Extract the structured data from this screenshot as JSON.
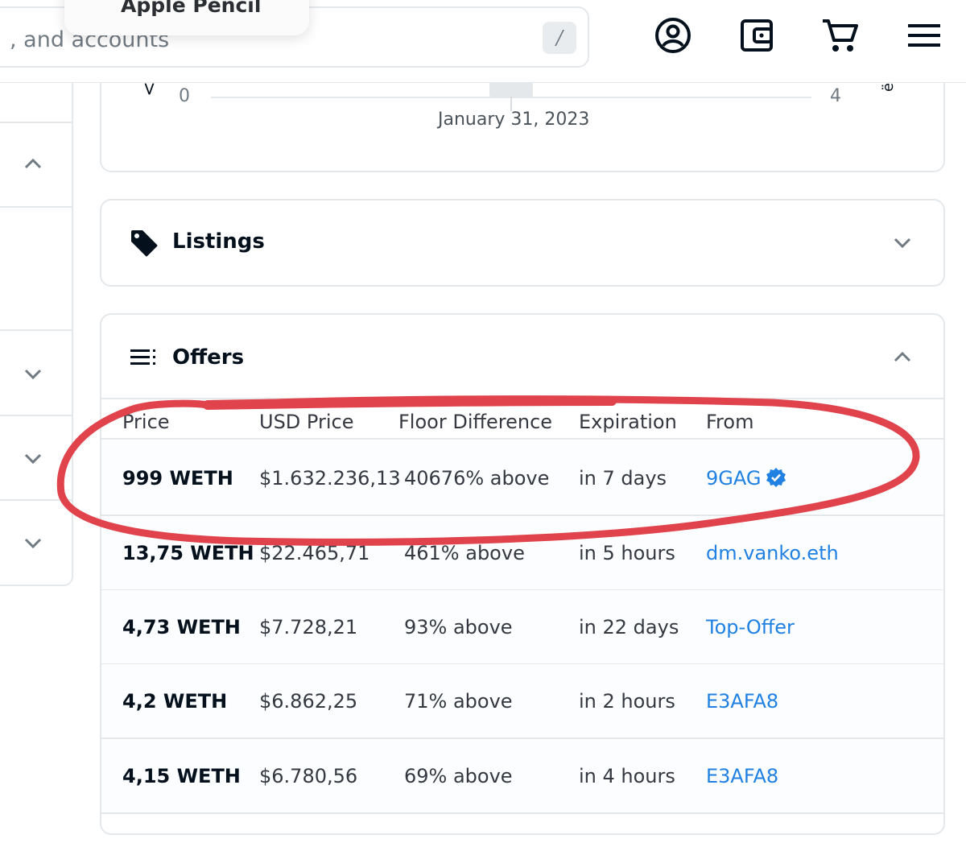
{
  "header": {
    "search_placeholder": ", and accounts",
    "search_shortcut": "/",
    "tooltip_label": "Apple Pencil",
    "icons": [
      "account-icon",
      "wallet-icon",
      "cart-icon",
      "menu-icon"
    ]
  },
  "chart": {
    "y_left_label": ">",
    "y_right_label": "ë",
    "axis_min": "0",
    "axis_max": "4",
    "date_label": "January 31, 2023"
  },
  "listings": {
    "title": "Listings"
  },
  "offers": {
    "title": "Offers",
    "columns": [
      "Price",
      "USD Price",
      "Floor Difference",
      "Expiration",
      "From"
    ],
    "rows": [
      {
        "price": "999 WETH",
        "usd": "$1.632.236,13",
        "floor": "40676% above",
        "expiration": "in 7 days",
        "from": "9GAG",
        "verified": true
      },
      {
        "price": "13,75 WETH",
        "usd": "$22.465,71",
        "floor": "461% above",
        "expiration": "in 5 hours",
        "from": "dm.vanko.eth",
        "verified": false
      },
      {
        "price": "4,73 WETH",
        "usd": "$7.728,21",
        "floor": "93% above",
        "expiration": "in 22 days",
        "from": "Top-Offer",
        "verified": false
      },
      {
        "price": "4,2 WETH",
        "usd": "$6.862,25",
        "floor": "71% above",
        "expiration": "in 2 hours",
        "from": "E3AFA8",
        "verified": false
      },
      {
        "price": "4,15 WETH",
        "usd": "$6.780,56",
        "floor": "69% above",
        "expiration": "in 4 hours",
        "from": "E3AFA8",
        "verified": false
      }
    ]
  },
  "colors": {
    "link": "#2081e2",
    "text": "#04111d",
    "border": "#e5e8eb",
    "annotation": "#e0434b"
  }
}
